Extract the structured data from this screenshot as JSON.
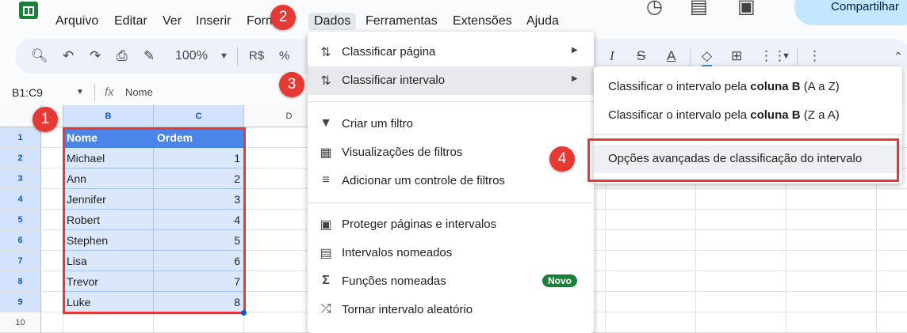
{
  "menubar": {
    "items": [
      "Arquivo",
      "Editar",
      "Ver",
      "Inserir",
      "Formatar",
      "Dados",
      "Ferramentas",
      "Extensões",
      "Ajuda"
    ],
    "share_label": "Compartilhar"
  },
  "toolbar": {
    "zoom": "100%",
    "currency": "R$",
    "percent": "%"
  },
  "formula_bar": {
    "name_box": "B1:C9",
    "fx": "fx",
    "content": "Nome"
  },
  "grid": {
    "columns": [
      "B",
      "C",
      "D"
    ],
    "rows": [
      "1",
      "2",
      "3",
      "4",
      "5",
      "6",
      "7",
      "8",
      "9",
      "10"
    ],
    "header": [
      "Nome",
      "Ordem"
    ],
    "data": [
      [
        "Michael",
        "1"
      ],
      [
        "Ann",
        "2"
      ],
      [
        "Jennifer",
        "3"
      ],
      [
        "Robert",
        "4"
      ],
      [
        "Stephen",
        "5"
      ],
      [
        "Lisa",
        "6"
      ],
      [
        "Trevor",
        "7"
      ],
      [
        "Luke",
        "8"
      ]
    ]
  },
  "badges": [
    "1",
    "2",
    "3",
    "4"
  ],
  "data_menu": {
    "items": [
      {
        "label": "Classificar página",
        "icon": "sort-icon",
        "submenu": true
      },
      {
        "label": "Classificar intervalo",
        "icon": "sort-icon",
        "submenu": true
      },
      {
        "label": "Criar um filtro",
        "icon": "filter-icon"
      },
      {
        "label": "Visualizações de filtros",
        "icon": "filter-views-icon"
      },
      {
        "label": "Adicionar um controle de filtros",
        "icon": "filter-control-icon"
      },
      {
        "label": "Proteger páginas e intervalos",
        "icon": "lock-icon"
      },
      {
        "label": "Intervalos nomeados",
        "icon": "named-ranges-icon"
      },
      {
        "label": "Funções nomeadas",
        "icon": "sigma-icon",
        "badge": "Novo"
      },
      {
        "label": "Tornar intervalo aleatório",
        "icon": "shuffle-icon"
      }
    ]
  },
  "sort_submenu": {
    "items": [
      {
        "prefix": "Classificar o intervalo pela ",
        "bold": "coluna B",
        "suffix": " (A a Z)"
      },
      {
        "prefix": "Classificar o intervalo pela ",
        "bold": "coluna B",
        "suffix": " (Z a A)"
      },
      {
        "prefix": "Opções avançadas de classificação do intervalo",
        "bold": "",
        "suffix": ""
      }
    ]
  },
  "colors": {
    "header_fill": "#4a86e8",
    "annotation_red": "#e53935",
    "novo_badge": "#188038"
  }
}
